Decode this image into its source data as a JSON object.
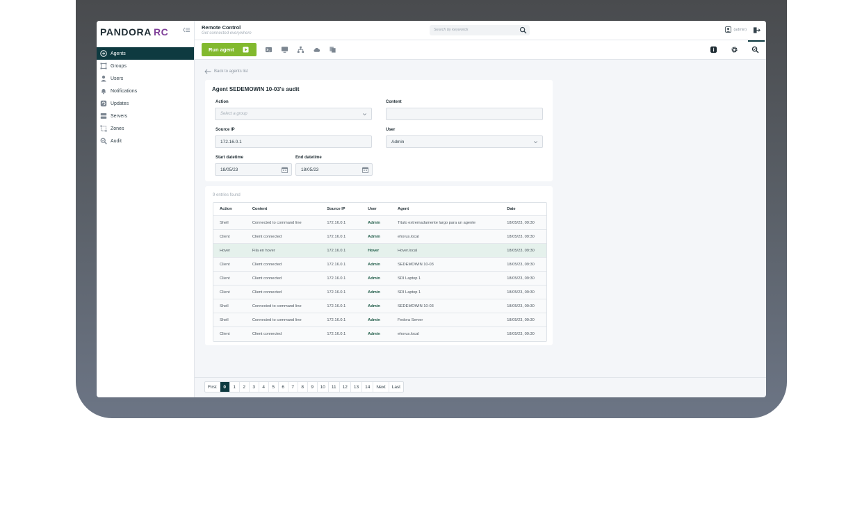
{
  "brand": {
    "name": "PANDORA",
    "suffix": "RC",
    "suffix_color": "#7f3f98"
  },
  "sidebar": {
    "items": [
      {
        "label": "Agents",
        "icon": "agents-icon",
        "active": true
      },
      {
        "label": "Groups",
        "icon": "groups-icon"
      },
      {
        "label": "Users",
        "icon": "users-icon"
      },
      {
        "label": "Notifications",
        "icon": "bell-icon"
      },
      {
        "label": "Updates",
        "icon": "updates-icon"
      },
      {
        "label": "Servers",
        "icon": "servers-icon"
      },
      {
        "label": "Zones",
        "icon": "zones-icon"
      },
      {
        "label": "Audit",
        "icon": "audit-icon"
      }
    ]
  },
  "header": {
    "title": "Remote Control",
    "subtitle": "Get connected everywhere",
    "search_placeholder": "Search by keywords",
    "user": "(admin)"
  },
  "toolbar": {
    "run_label": "Run agent"
  },
  "back_label": "Back to agents list",
  "audit_form": {
    "title": "Agent SEDEMOWIN 10-03's audit",
    "action_label": "Action",
    "action_placeholder": "Select a group",
    "content_label": "Content",
    "content_value": "",
    "source_ip_label": "Source IP",
    "source_ip_value": "172.16.0.1",
    "user_label": "User",
    "user_value": "Admin",
    "start_label": "Start datetime",
    "start_value": "18/05/23",
    "end_label": "End datetime",
    "end_value": "18/05/23"
  },
  "results": {
    "count_text": "9 entries found",
    "columns": [
      "Action",
      "Content",
      "Source IP",
      "User",
      "Agent",
      "Date"
    ],
    "rows": [
      [
        "Shell",
        "Connected to command line",
        "172.16.0.1",
        "Admin",
        "Titulo extremadamente largo para un agente",
        "18/05/23, 09:30"
      ],
      [
        "Client",
        "Client connected",
        "172.16.0.1",
        "Admin",
        "ehorus.local",
        "18/05/23, 09:30"
      ],
      [
        "Hover",
        "Fila en hover",
        "172.16.0.1",
        "Hover",
        "Hover.local",
        "18/05/23, 09:30"
      ],
      [
        "Client",
        "Client connected",
        "172.16.0.1",
        "Admin",
        "SEDEMOWIN 10-03",
        "18/05/23, 09:30"
      ],
      [
        "Client",
        "Client connected",
        "172.16.0.1",
        "Admin",
        "SDI Laptop 1",
        "18/05/23, 09:30"
      ],
      [
        "Client",
        "Client connected",
        "172.16.0.1",
        "Admin",
        "SDI Laptop 1",
        "18/05/23, 09:30"
      ],
      [
        "Shell",
        "Connected to command line",
        "172.16.0.1",
        "Admin",
        "SEDEMOWIN 10-03",
        "18/05/23, 09:30"
      ],
      [
        "Shell",
        "Connected to command line",
        "172.16.0.1",
        "Admin",
        "Fedora Server",
        "18/05/23, 09:30"
      ],
      [
        "Client",
        "Client connected",
        "172.16.0.1",
        "Admin",
        "ehorus.local",
        "18/05/23, 09:30"
      ]
    ],
    "hover_row": 2
  },
  "pagination": {
    "pages": [
      "First",
      "0",
      "1",
      "2",
      "3",
      "4",
      "5",
      "6",
      "7",
      "8",
      "9",
      "10",
      "11",
      "12",
      "13",
      "14",
      "Next",
      "Last"
    ],
    "current": "0"
  },
  "colors": {
    "accent": "#0e3a40",
    "run_button": "#82b92e",
    "admin_text": "#1d5a46",
    "hover_row": "#e5f1ec"
  }
}
